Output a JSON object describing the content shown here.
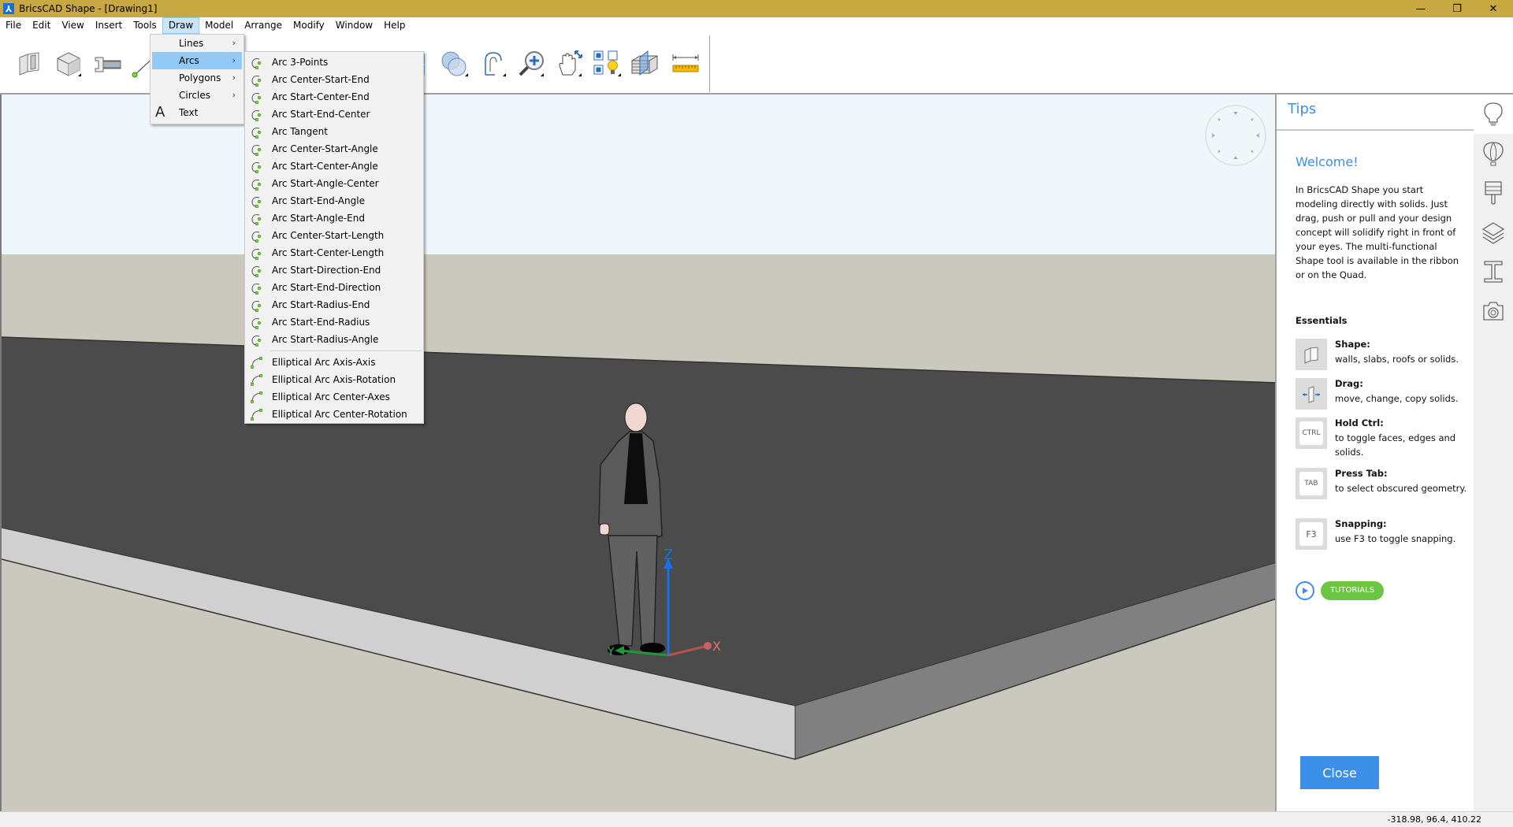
{
  "window": {
    "title": "BricsCAD Shape - [Drawing1]",
    "app_icon": "bricscad-logo-icon",
    "controls": [
      "minimize-icon",
      "restore-icon",
      "close-icon"
    ]
  },
  "menubar": {
    "items": [
      {
        "label": "File"
      },
      {
        "label": "Edit"
      },
      {
        "label": "View"
      },
      {
        "label": "Insert"
      },
      {
        "label": "Tools"
      },
      {
        "label": "Draw",
        "active": true
      },
      {
        "label": "Model"
      },
      {
        "label": "Arrange"
      },
      {
        "label": "Modify"
      },
      {
        "label": "Window"
      },
      {
        "label": "Help"
      }
    ]
  },
  "ribbon": {
    "tools": [
      "shape-wall-icon",
      "solid-box-icon",
      "beam-profile-icon",
      "line-icon",
      "boolean-icon",
      "region-icon",
      "zoom-in-icon",
      "pan-orbit-icon",
      "select-visibility-icon",
      "section-icon",
      "measure-icon"
    ]
  },
  "draw_menu": {
    "items": [
      {
        "label": "Lines",
        "submenu": true
      },
      {
        "label": "Arcs",
        "submenu": true,
        "highlighted": true
      },
      {
        "label": "Polygons",
        "submenu": true
      },
      {
        "label": "Circles",
        "submenu": true
      },
      {
        "label": "Text",
        "icon": "text-A-icon"
      }
    ]
  },
  "arcs_menu": {
    "items": [
      "Arc 3-Points",
      "Arc Center-Start-End",
      "Arc Start-Center-End",
      "Arc Start-End-Center",
      "Arc Tangent",
      "Arc Center-Start-Angle",
      "Arc Start-Center-Angle",
      "Arc Start-Angle-Center",
      "Arc Start-End-Angle",
      "Arc Start-Angle-End",
      "Arc Center-Start-Length",
      "Arc Start-Center-Length",
      "Arc Start-Direction-End",
      "Arc Start-End-Direction",
      "Arc Start-Radius-End",
      "Arc Start-End-Radius",
      "Arc Start-Radius-Angle"
    ],
    "elliptical_items": [
      "Elliptical Arc Axis-Axis",
      "Elliptical Arc Axis-Rotation",
      "Elliptical Arc Center-Axes",
      "Elliptical Arc Center-Rotation"
    ]
  },
  "viewport": {
    "axis_labels": {
      "x": "X",
      "y": "Y",
      "z": "Z"
    },
    "colors": {
      "sky": "#f0f7fb",
      "ground": "#cbc9bd",
      "slab_top": "#4b4b4b",
      "slab_front": "#d0d0d0",
      "slab_side": "#808080"
    }
  },
  "tips": {
    "header": "Tips",
    "welcome": "Welcome!",
    "intro": "In BricsCAD Shape you start modeling directly with solids. Just drag, push or pull and your design concept will solidify right in front of your eyes. The multi-functional Shape tool is available in the ribbon or on the Quad.",
    "essentials_title": "Essentials",
    "essentials": [
      {
        "title": "Shape:",
        "desc": "walls, slabs, roofs or solids.",
        "icon": "shape-icon"
      },
      {
        "title": "Drag:",
        "desc": "move, change, copy solids.",
        "icon": "drag-icon"
      },
      {
        "title": "Hold Ctrl:",
        "desc": "to toggle faces, edges and solids.",
        "key": "CTRL"
      },
      {
        "title": "Press Tab:",
        "desc": "to select obscured geometry.",
        "key": "TAB"
      },
      {
        "title": "Snapping:",
        "desc": "use F3 to toggle snapping.",
        "key": "F3"
      }
    ],
    "tutorials_label": "TUTORIALS",
    "close_label": "Close"
  },
  "sidebar": {
    "icons": [
      "lightbulb-icon",
      "balloon-icon",
      "paintbrush-icon",
      "layers-icon",
      "beam-icon",
      "camera-icon"
    ]
  },
  "statusbar": {
    "coords": "-318.98, 96.4, 410.22"
  }
}
